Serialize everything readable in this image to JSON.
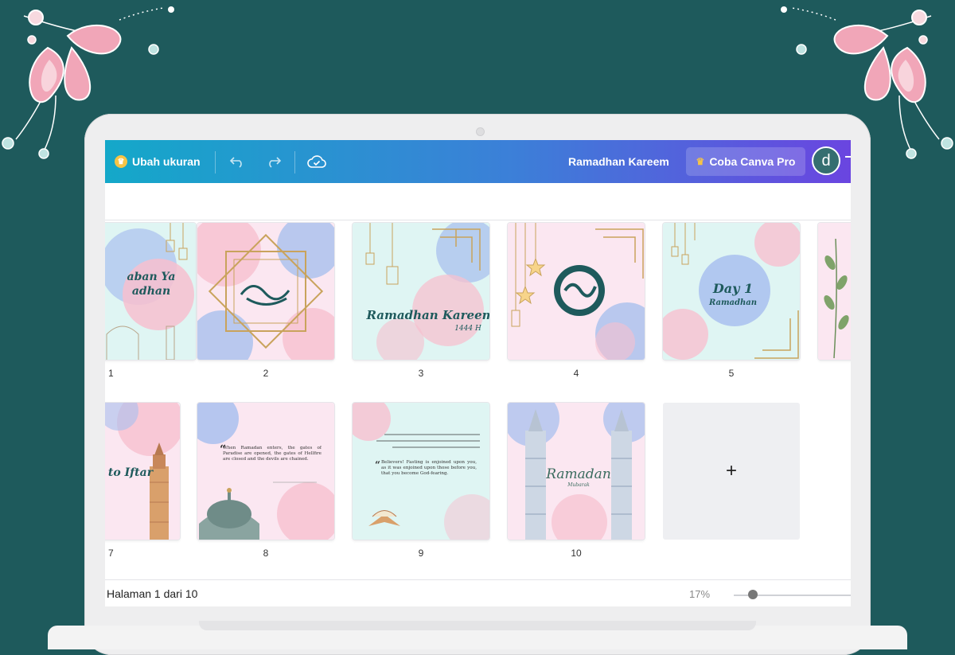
{
  "toolbar": {
    "resize_label": "Ubah ukuran",
    "doc_title": "Ramadhan Kareem",
    "pro_label": "Coba Canva Pro",
    "avatar_initial": "d"
  },
  "pages": [
    {
      "number": "1",
      "text": "aban Ya\nadhan"
    },
    {
      "number": "2",
      "text": ""
    },
    {
      "number": "3",
      "text": "Ramadhan Kareem",
      "sub": "1444 H"
    },
    {
      "number": "4",
      "text": ""
    },
    {
      "number": "5",
      "text": "Day 1",
      "sub": "Ramadhan"
    },
    {
      "number": "",
      "text": ""
    },
    {
      "number": "7",
      "text": "to Iftar"
    },
    {
      "number": "8",
      "text": "When Ramadan enters, the gates of Paradise are opened, the gates of Hellfire are closed and the devils are chained."
    },
    {
      "number": "9",
      "text": "Believers! Fasting is enjoined upon you, as it was enjoined upon those before you, that you become God-fearing."
    },
    {
      "number": "10",
      "text": "Ramadan",
      "sub": "Mubarak"
    }
  ],
  "footer": {
    "page_info": "Halaman 1 dari 10",
    "zoom": "17%",
    "zoom_value": 0.17
  },
  "colors": {
    "teal_bg": "#1e5a5c",
    "gradient_start": "#14a8c9",
    "gradient_end": "#6a45e0",
    "crown": "#f6c445",
    "pink": "#f7c6d6",
    "blue": "#8fa8e8",
    "mint": "#dff5f3",
    "gold": "#c9a35c"
  },
  "add_page_symbol": "+"
}
